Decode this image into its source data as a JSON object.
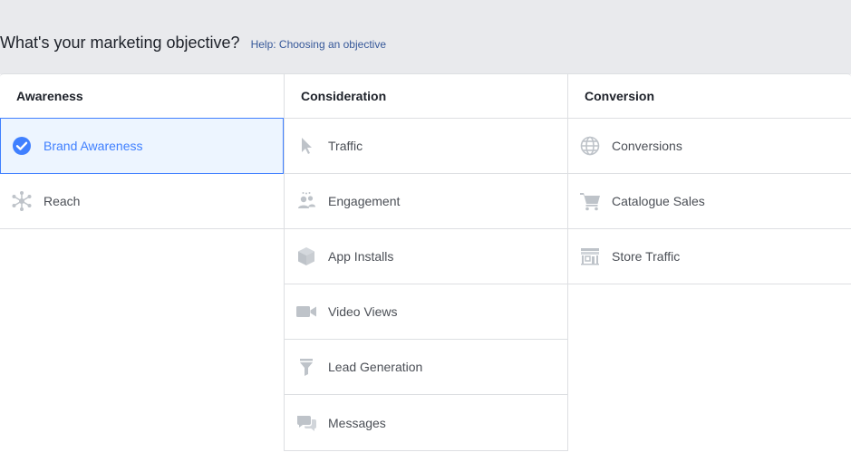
{
  "heading": {
    "title": "What's your marketing objective?",
    "help_link": "Help: Choosing an objective"
  },
  "colors": {
    "accent": "#4080ff",
    "selected_bg": "#edf5ff",
    "icon_gray": "#bec3c9",
    "link": "#365899"
  },
  "columns": [
    {
      "title": "Awareness",
      "items": [
        {
          "label": "Brand Awareness",
          "icon": "check-circle-icon",
          "selected": true
        },
        {
          "label": "Reach",
          "icon": "reach-icon",
          "selected": false
        }
      ]
    },
    {
      "title": "Consideration",
      "items": [
        {
          "label": "Traffic",
          "icon": "cursor-icon"
        },
        {
          "label": "Engagement",
          "icon": "people-icon"
        },
        {
          "label": "App Installs",
          "icon": "box-icon"
        },
        {
          "label": "Video Views",
          "icon": "video-camera-icon"
        },
        {
          "label": "Lead Generation",
          "icon": "funnel-icon"
        },
        {
          "label": "Messages",
          "icon": "chat-bubbles-icon"
        }
      ]
    },
    {
      "title": "Conversion",
      "items": [
        {
          "label": "Conversions",
          "icon": "globe-icon"
        },
        {
          "label": "Catalogue Sales",
          "icon": "shopping-cart-icon"
        },
        {
          "label": "Store Traffic",
          "icon": "storefront-icon"
        }
      ]
    }
  ]
}
